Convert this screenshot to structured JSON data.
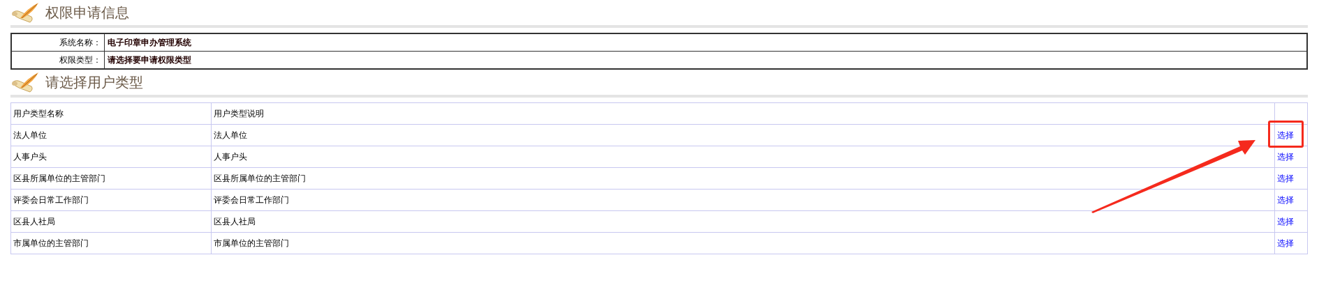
{
  "sections": [
    {
      "title": "权限申请信息",
      "kind": "info",
      "fields": [
        {
          "label": "系统名称：",
          "value": "电子印章申办管理系统"
        },
        {
          "label": "权限类型：",
          "value": "请选择要申请权限类型"
        }
      ]
    },
    {
      "title": "请选择用户类型",
      "kind": "list",
      "columns": [
        "用户类型名称",
        "用户类型说明"
      ],
      "rows": [
        {
          "name": "法人单位",
          "description": "法人单位",
          "action": "选择",
          "annotated": true
        },
        {
          "name": "人事户头",
          "description": "人事户头",
          "action": "选择",
          "annotated": false
        },
        {
          "name": "区县所属单位的主管部门",
          "description": "区县所属单位的主管部门",
          "action": "选择",
          "annotated": false
        },
        {
          "name": "评委会日常工作部门",
          "description": "评委会日常工作部门",
          "action": "选择",
          "annotated": false
        },
        {
          "name": "区县人社局",
          "description": "区县人社局",
          "action": "选择",
          "annotated": false
        },
        {
          "name": "市属单位的主管部门",
          "description": "市属单位的主管部门",
          "action": "选择",
          "annotated": false
        }
      ]
    }
  ]
}
